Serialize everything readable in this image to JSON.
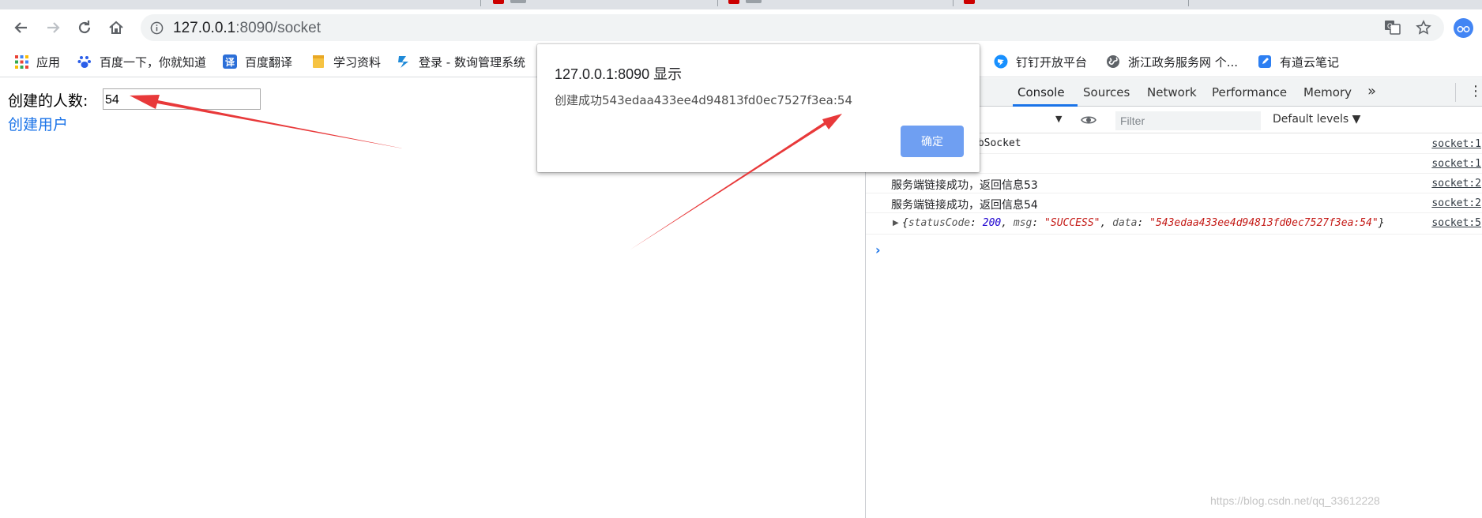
{
  "browser": {
    "url_host": "127.0.0.1",
    "url_rest": ":8090/socket"
  },
  "bookmarks": [
    {
      "label": "应用",
      "icon": "apps-grid-icon"
    },
    {
      "label": "百度一下，你就知道",
      "icon": "baidu-paw-icon"
    },
    {
      "label": "百度翻译",
      "icon": "translate-icon"
    },
    {
      "label": "学习资料",
      "icon": "folder-icon"
    },
    {
      "label": "登录 - 数询管理系统",
      "icon": "bookmark-s-icon"
    },
    {
      "label": "钉钉开放平台",
      "icon": "dingtalk-icon"
    },
    {
      "label": "浙江政务服务网 个...",
      "icon": "globe-icon"
    },
    {
      "label": "有道云笔记",
      "icon": "note-icon"
    }
  ],
  "page": {
    "count_label": "创建的人数:",
    "count_value": "54",
    "create_link": "创建用户"
  },
  "devtools": {
    "tabs": [
      "nts",
      "Console",
      "Sources",
      "Network",
      "Performance",
      "Memory"
    ],
    "active_tab": "Console",
    "filter_placeholder": "Filter",
    "levels": "Default levels ▼",
    "logs": [
      {
        "msg": "ebSocket",
        "src": "socket:1"
      },
      {
        "msg": "",
        "src": "socket:1"
      },
      {
        "msg": "服务端链接成功，返回信息53",
        "src": "socket:2"
      },
      {
        "msg": "服务端链接成功，返回信息54",
        "src": "socket:2"
      }
    ],
    "object_log": {
      "status_key": "statusCode",
      "status_value": "200",
      "msg_key": "msg",
      "msg_value": "\"SUCCESS\"",
      "data_key": "data",
      "data_value": "\"543edaa433ee4d94813fd0ec7527f3ea:54\"",
      "src": "socket:5"
    }
  },
  "dialog": {
    "title": "127.0.0.1:8090 显示",
    "message": "创建成功543edaa433ee4d94813fd0ec7527f3ea:54",
    "ok_label": "确定"
  },
  "watermark": "https://blog.csdn.net/qq_33612228",
  "colors": {
    "link": "#1a73e8",
    "ok_button": "#6f9ff2",
    "annotation_arrow": "#e8393a"
  }
}
